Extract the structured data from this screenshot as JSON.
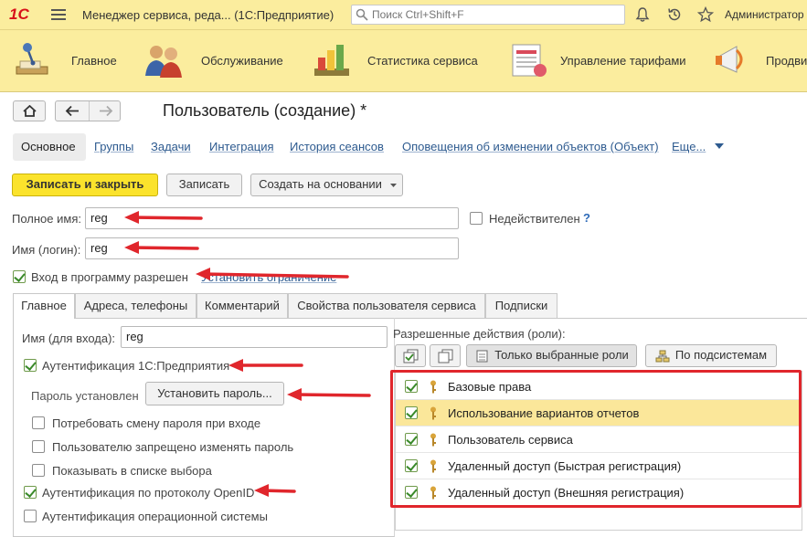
{
  "app": {
    "title": "Менеджер сервиса, реда...  (1С:Предприятие)",
    "search_placeholder": "Поиск Ctrl+Shift+F",
    "user": "Администратор",
    "logo_text": "1С"
  },
  "sections": [
    {
      "label": "Главное"
    },
    {
      "label": "Обслуживание"
    },
    {
      "label": "Статистика сервиса"
    },
    {
      "label": "Управление тарифами"
    },
    {
      "label": "Продви"
    }
  ],
  "form": {
    "title": "Пользователь (создание) *",
    "nav_links": [
      "Основное",
      "Группы",
      "Задачи",
      "Интеграция",
      "История сеансов",
      "Оповещения об изменении объектов (Объект)",
      "Еще..."
    ],
    "buttons": {
      "save_close": "Записать и закрыть",
      "save": "Записать",
      "create_based": "Создать на основании"
    },
    "full_name_label": "Полное имя:",
    "full_name_value": "reg",
    "inactive_label": "Недействителен",
    "help_mark": "?",
    "login_label": "Имя (логин):",
    "login_value": "reg",
    "login_allowed_label": "Вход в программу разрешен",
    "set_restriction_link": "Установить ограничение"
  },
  "tabs": [
    "Главное",
    "Адреса, телефоны",
    "Комментарий",
    "Свойства пользователя сервиса",
    "Подписки"
  ],
  "main_tab": {
    "login_name_label": "Имя (для входа):",
    "login_name_value": "reg",
    "auth_1c_label": "Аутентификация 1С:Предприятия",
    "password_set_label": "Пароль установлен",
    "set_password_button": "Установить пароль...",
    "require_change_label": "Потребовать смену пароля при входе",
    "forbid_change_label": "Пользователю запрещено изменять пароль",
    "show_in_list_label": "Показывать в списке выбора",
    "auth_openid_label": "Аутентификация по протоколу OpenID",
    "auth_os_label": "Аутентификация операционной системы"
  },
  "roles": {
    "header": "Разрешенные действия (роли):",
    "only_selected_button": "Только выбранные роли",
    "by_subsystems_button": "По подсистемам",
    "items": [
      {
        "label": "Базовые права",
        "checked": true,
        "selected": false
      },
      {
        "label": "Использование вариантов отчетов",
        "checked": true,
        "selected": true
      },
      {
        "label": "Пользователь сервиса",
        "checked": true,
        "selected": false
      },
      {
        "label": "Удаленный доступ (Быстрая регистрация)",
        "checked": true,
        "selected": false
      },
      {
        "label": "Удаленный доступ (Внешняя регистрация)",
        "checked": true,
        "selected": false
      }
    ]
  },
  "colors": {
    "panel_bg": "#fbed9e",
    "primary_button": "#fbe32c",
    "annotation_red": "#e0262c",
    "selected_row": "#fbe79a",
    "link": "#2d5a8f"
  }
}
